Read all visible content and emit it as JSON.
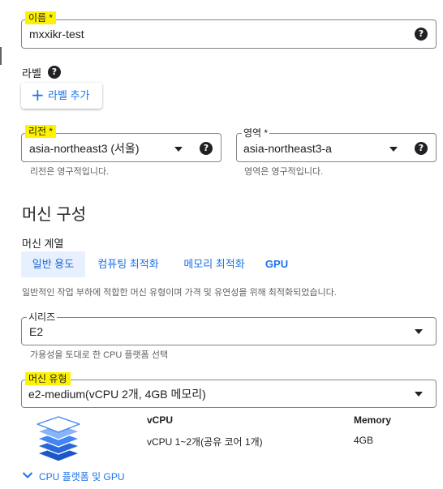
{
  "name_field": {
    "label": "이름 *",
    "value": "mxxikr-test",
    "help": "?"
  },
  "labels": {
    "title": "라벨",
    "help": "?",
    "add_button_icon": "+",
    "add_button_label": "라벨 추가"
  },
  "region": {
    "label": "리전 *",
    "value": "asia-northeast3 (서울)",
    "help": "?",
    "hint": "리전은 영구적입니다."
  },
  "zone": {
    "label": "영역 *",
    "value": "asia-northeast3-a",
    "help": "?",
    "hint": "영역은 영구적입니다."
  },
  "machine_config": {
    "title": "머신 구성",
    "family_label": "머신 계열",
    "tabs": [
      {
        "label": "일반 용도",
        "active": true
      },
      {
        "label": "컴퓨팅 최적화",
        "active": false
      },
      {
        "label": "메모리 최적화",
        "active": false
      },
      {
        "label": "GPU",
        "active": false
      }
    ],
    "description": "일반적인 작업 부하에 적합한 머신 유형이며 가격 및 유연성을 위해 최적화되었습니다.",
    "series": {
      "label": "시리즈",
      "value": "E2",
      "hint": "가용성을 토대로 한 CPU 플랫폼 선택"
    },
    "machine_type": {
      "label": "머신 유형",
      "value": "e2-medium(vCPU 2개, 4GB 메모리)"
    },
    "specs": {
      "headers": [
        "vCPU",
        "Memory"
      ],
      "values": [
        "vCPU 1~2개(공유 코어 1개)",
        "4GB"
      ]
    },
    "cpu_platform_toggle": "CPU 플랫폼 및 GPU"
  },
  "colors": {
    "highlight": "#fff200",
    "link": "#1a73e8",
    "active_tab_bg": "#e8f0fe",
    "stack_icon": "#4285f4"
  },
  "icons": [
    "help-circle-icon",
    "plus-icon",
    "dropdown-arrow-icon",
    "chevron-down-icon",
    "layers-stack-icon"
  ]
}
